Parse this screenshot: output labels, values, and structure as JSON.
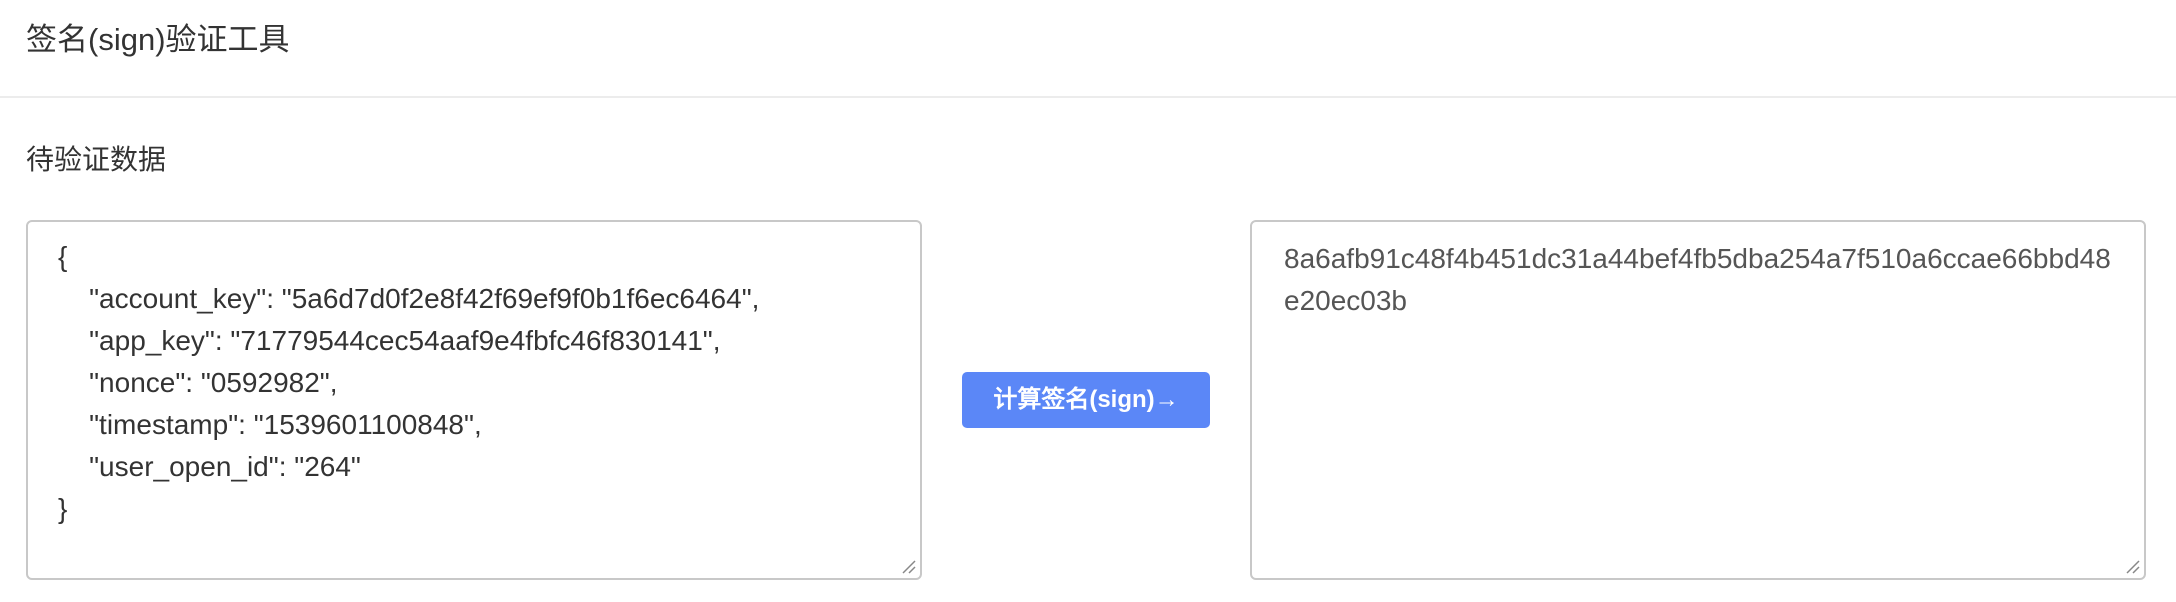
{
  "header": {
    "title": "签名(sign)验证工具"
  },
  "input_section": {
    "label": "待验证数据",
    "value": "{\n    \"account_key\": \"5a6d7d0f2e8f42f69ef9f0b1f6ec6464\",\n    \"app_key\": \"71779544cec54aaf9e4fbfc46f830141\",\n    \"nonce\": \"0592982\",\n    \"timestamp\": \"1539601100848\",\n    \"user_open_id\": \"264\"\n}"
  },
  "action": {
    "compute_label": "计算签名(sign)→",
    "color": "#5b87f7"
  },
  "output_section": {
    "value": "8a6afb91c48f4b451dc31a44bef4fb5dba254a7f510a6ccae66bbd48e20ec03b"
  },
  "icons": {
    "resize_grip": "resize-grip-icon"
  }
}
